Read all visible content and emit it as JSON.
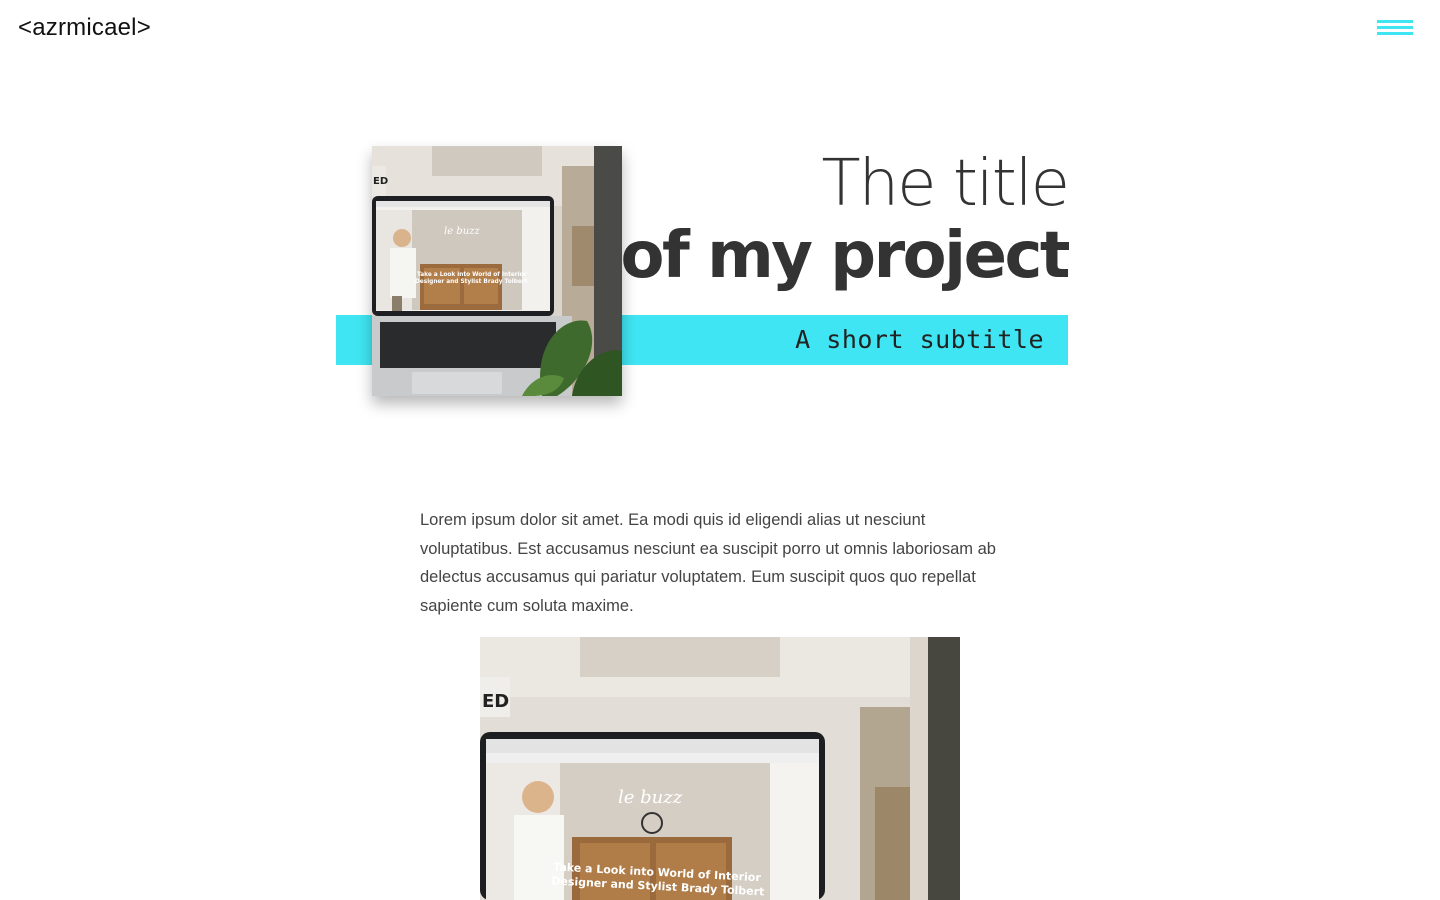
{
  "header": {
    "logo": "<azrmicael>",
    "menu_icon": "hamburger-icon"
  },
  "hero": {
    "title_light": "The title",
    "title_bold": "of my project",
    "subtitle": "A short subtitle",
    "image_alt": "Laptop displaying a website mockup"
  },
  "content": {
    "intro": "Lorem ipsum dolor sit amet. Ea modi quis id eligendi alias ut nesciunt voluptatibus. Est accusamus nesciunt ea suscipit porro ut omnis laboriosam ab delectus accusamus qui pariatur voluptatem. Eum suscipit quos quo repellat sapiente cum soluta maxime.",
    "image_alt": "Laptop displaying a website mockup"
  },
  "screen_mockup": {
    "brand": "le buzz",
    "headline_1": "Take a Look into World of Interior",
    "headline_2": "Designer and Stylist Brady Tolbert"
  },
  "colors": {
    "accent": "#3fe5f2",
    "text_dark": "#333333"
  }
}
